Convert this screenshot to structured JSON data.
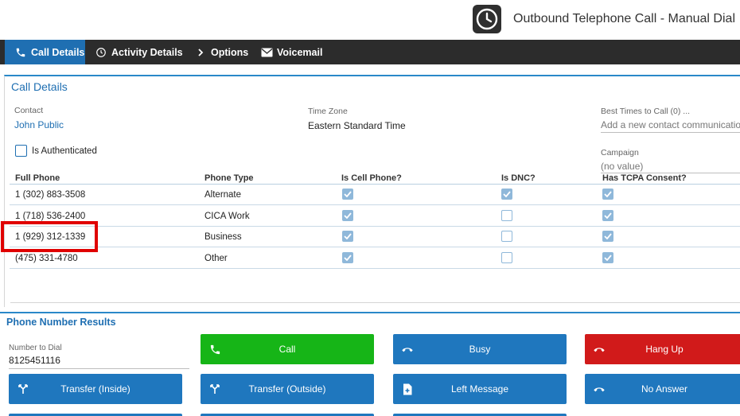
{
  "header": {
    "clock_icon": "clock-icon",
    "title": "Outbound Telephone Call - Manual Dial"
  },
  "tabs": [
    {
      "label": "Call Details",
      "icon": "phone-icon",
      "active": true
    },
    {
      "label": "Activity Details",
      "icon": "clock-icon",
      "active": false
    },
    {
      "label": "Options",
      "icon": "chevron-right-icon",
      "active": false
    },
    {
      "label": "Voicemail",
      "icon": "envelope-icon",
      "active": false
    }
  ],
  "call_details": {
    "title": "Call Details",
    "contact_label": "Contact",
    "contact_value": "John Public",
    "timezone_label": "Time Zone",
    "timezone_value": "Eastern Standard Time",
    "best_times_label": "Best Times to Call (0) ...",
    "best_times_link": "Add a new contact communication",
    "authenticated_label": "Is Authenticated",
    "campaign_label": "Campaign",
    "campaign_value": "(no value)"
  },
  "phones": {
    "headers": [
      "Full Phone",
      "Phone Type",
      "Is Cell Phone?",
      "Is DNC?",
      "Has TCPA Consent?"
    ],
    "rows": [
      {
        "phone": "1 (302) 883-3508",
        "type": "Alternate",
        "cell": true,
        "dnc": true,
        "tcpa": true
      },
      {
        "phone": "1 (718) 536-2400",
        "type": "CICA Work",
        "cell": true,
        "dnc": false,
        "tcpa": true
      },
      {
        "phone": "1 (929) 312-1339",
        "type": "Business",
        "cell": true,
        "dnc": false,
        "tcpa": true
      },
      {
        "phone": "(475) 331-4780",
        "type": "Other",
        "cell": true,
        "dnc": false,
        "tcpa": true
      }
    ]
  },
  "results": {
    "title": "Phone Number Results",
    "number_label": "Number to Dial",
    "number_value": "8125451116",
    "buttons": {
      "call": "Call",
      "busy": "Busy",
      "hang_up": "Hang Up",
      "transfer_inside": "Transfer (Inside)",
      "transfer_outside": "Transfer (Outside)",
      "left_message": "Left Message",
      "no_answer": "No Answer"
    }
  },
  "colors": {
    "accent": "#1f6fb2",
    "call_green": "#16b517",
    "hangup_red": "#d11a1a",
    "highlight": "#e00000"
  }
}
